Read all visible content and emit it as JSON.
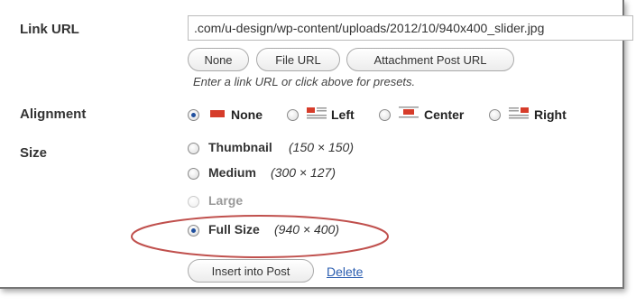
{
  "link_url": {
    "label": "Link URL",
    "value": ".com/u-design/wp-content/uploads/2012/10/940x400_slider.jpg",
    "buttons": [
      "None",
      "File URL",
      "Attachment Post URL"
    ],
    "hint": "Enter a link URL or click above for presets."
  },
  "alignment": {
    "label": "Alignment",
    "options": [
      {
        "label": "None",
        "checked": true,
        "icon": "align-none-icon"
      },
      {
        "label": "Left",
        "checked": false,
        "icon": "align-left-icon"
      },
      {
        "label": "Center",
        "checked": false,
        "icon": "align-center-icon"
      },
      {
        "label": "Right",
        "checked": false,
        "icon": "align-right-icon"
      }
    ]
  },
  "size": {
    "label": "Size",
    "options": [
      {
        "label": "Thumbnail",
        "dims": "(150 × 150)",
        "checked": false,
        "disabled": false
      },
      {
        "label": "Medium",
        "dims": "(300 × 127)",
        "checked": false,
        "disabled": false
      },
      {
        "label": "Large",
        "dims": "",
        "checked": false,
        "disabled": true
      },
      {
        "label": "Full Size",
        "dims": "(940 × 400)",
        "checked": true,
        "disabled": false
      }
    ]
  },
  "actions": {
    "insert_label": "Insert into Post",
    "delete_label": "Delete"
  },
  "colors": {
    "highlight_ellipse": "#c0504d",
    "link": "#2a5db0",
    "icon_red": "#d63c2a"
  }
}
